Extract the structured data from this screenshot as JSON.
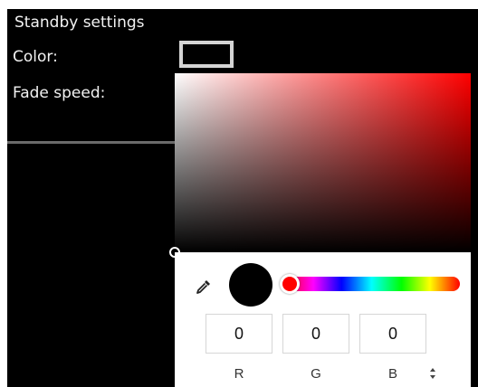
{
  "standby": {
    "title": "Standby settings",
    "color_label": "Color:",
    "fade_label": "Fade speed:",
    "swatch_color": "#000000"
  },
  "picker": {
    "base_hue_color": "#ff0000",
    "selected_color": "#000000",
    "hue_value": 0,
    "channels": [
      {
        "label": "R",
        "value": "0"
      },
      {
        "label": "G",
        "value": "0"
      },
      {
        "label": "B",
        "value": "0"
      }
    ],
    "icons": {
      "eyedropper": "eyedropper-icon",
      "mode_toggle": "up-down-arrows-icon"
    }
  }
}
